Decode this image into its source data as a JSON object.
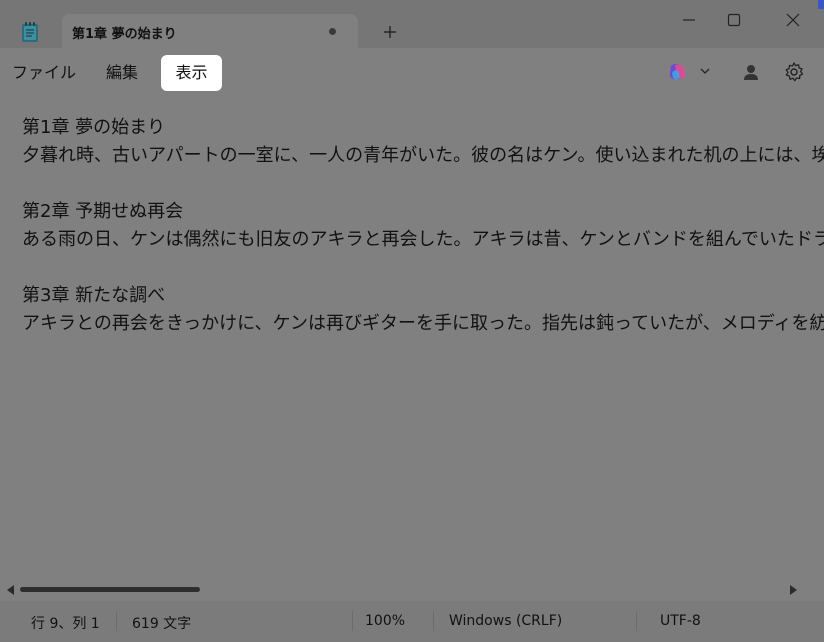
{
  "tab": {
    "title": "第1章 夢の始まり",
    "unsaved_indicator": "unsaved-dot",
    "new_tab_icon": "plus-icon"
  },
  "window_controls": [
    "minimize-icon",
    "maximize-icon",
    "close-icon"
  ],
  "menu": {
    "items": [
      {
        "label": "ファイル"
      },
      {
        "label": "編集"
      },
      {
        "label": "表示",
        "active": true
      }
    ]
  },
  "toolbar": {
    "copilot_icon": "copilot-icon",
    "copilot_dropdown_icon": "chevron-down-icon",
    "account_icon": "account-icon",
    "settings_icon": "gear-icon"
  },
  "document": {
    "lines": [
      "第1章 夢の始まり",
      "夕暮れ時、古いアパートの一室に、一人の青年がいた。彼の名はケン。使い込まれた机の上には、埃をか",
      "",
      "第2章 予期せぬ再会",
      "ある雨の日、ケンは偶然にも旧友のアキラと再会した。アキラは昔、ケンとバンドを組んでいたドラマーだ。ガ",
      "",
      "第3章 新たな調べ",
      "アキラとの再会をきっかけに、ケンは再びギターを手に取った。指先は鈍っていたが、メロディを紡ぐたびに、失"
    ]
  },
  "status": {
    "position": "行 9、列 1",
    "char_count": "619 文字",
    "zoom": "100%",
    "line_ending": "Windows (CRLF)",
    "encoding": "UTF-8"
  },
  "colors": {
    "overlay_gray": "#808080",
    "active_menu_bg": "#ffffff",
    "text": "#111111"
  }
}
